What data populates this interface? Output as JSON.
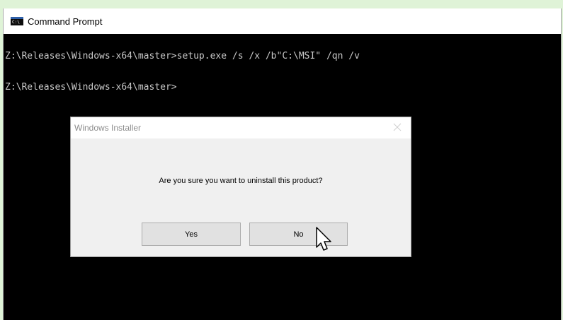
{
  "window": {
    "title": "Command Prompt",
    "icon_text": "C:\\"
  },
  "console": {
    "lines": [
      "Z:\\Releases\\Windows-x64\\master>setup.exe /s /x /b\"C:\\MSI\" /qn /v",
      "Z:\\Releases\\Windows-x64\\master>"
    ]
  },
  "dialog": {
    "title": "Windows Installer",
    "message": "Are you sure you want to uninstall this product?",
    "buttons": {
      "yes": "Yes",
      "no": "No"
    }
  },
  "icons": {
    "app": "command-prompt-icon",
    "close": "close-icon",
    "cursor": "mouse-pointer-icon"
  }
}
